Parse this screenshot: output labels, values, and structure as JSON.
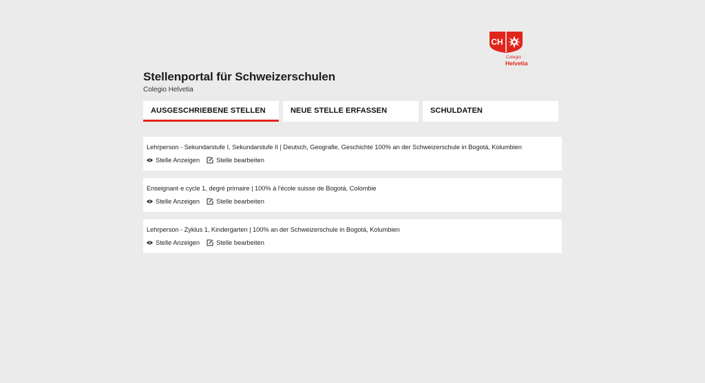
{
  "logo": {
    "mark_text": "CH",
    "caption_small": "Colegio",
    "caption_big": "Helvetia",
    "brand_color": "#e1251b"
  },
  "header": {
    "title": "Stellenportal für Schweizerschulen",
    "subtitle": "Colegio Helvetia"
  },
  "tabs": [
    {
      "label": "AUSGESCHRIEBENE STELLEN",
      "active": true
    },
    {
      "label": "NEUE STELLE ERFASSEN",
      "active": false
    },
    {
      "label": "SCHULDATEN",
      "active": false
    }
  ],
  "listings": [
    {
      "title": "Lehrperson - Sekundarstufe I, Sekundarstufe II | Deutsch, Geografie, Geschichte 100% an der Schweizerschule in Bogotá, Kolumbien",
      "view_label": "Stelle Anzeigen",
      "edit_label": "Stelle bearbeiten"
    },
    {
      "title": "Enseignant·e cycle 1, degré primaire | 100% à l'école suisse de Bogotá, Colombie",
      "view_label": "Stelle Anzeigen",
      "edit_label": "Stelle bearbeiten"
    },
    {
      "title": "Lehrperson - Zyklus 1, Kindergarten | 100% an der Schweizerschule in Bogotá, Kolumbien",
      "view_label": "Stelle Anzeigen",
      "edit_label": "Stelle bearbeiten"
    }
  ],
  "icons": {
    "view": "eye-icon",
    "edit": "edit-icon"
  }
}
